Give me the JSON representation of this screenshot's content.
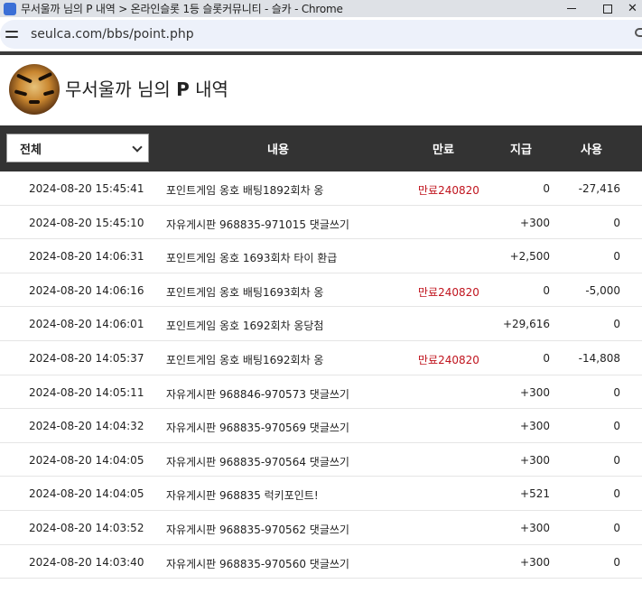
{
  "browser": {
    "tab_title": "무서울까 님의 P 내역 > 온라인슬롯 1등 슬롯커뮤니티 - 슬카 - Chrome",
    "url": "seulca.com/bbs/point.php"
  },
  "page": {
    "title_prefix": "무서울까 님의 ",
    "title_bold": "P",
    "title_suffix": " 내역"
  },
  "table": {
    "filter_value": "전체",
    "headers": {
      "content": "내용",
      "expire": "만료",
      "give": "지급",
      "use": "사용"
    },
    "rows": [
      {
        "date": "2024-08-20 15:45:41",
        "desc": "포인트게임 옹호 배팅1892회차 옹",
        "expire": "만료240820",
        "give": "0",
        "use": "-27,416"
      },
      {
        "date": "2024-08-20 15:45:10",
        "desc": "자유게시판 968835-971015 댓글쓰기",
        "expire": "",
        "give": "+300",
        "use": "0"
      },
      {
        "date": "2024-08-20 14:06:31",
        "desc": "포인트게임 옹호 1693회차 타이 환급",
        "expire": "",
        "give": "+2,500",
        "use": "0"
      },
      {
        "date": "2024-08-20 14:06:16",
        "desc": "포인트게임 옹호 배팅1693회차 옹",
        "expire": "만료240820",
        "give": "0",
        "use": "-5,000"
      },
      {
        "date": "2024-08-20 14:06:01",
        "desc": "포인트게임 옹호 1692회차 옹당첨",
        "expire": "",
        "give": "+29,616",
        "use": "0"
      },
      {
        "date": "2024-08-20 14:05:37",
        "desc": "포인트게임 옹호 배팅1692회차 옹",
        "expire": "만료240820",
        "give": "0",
        "use": "-14,808"
      },
      {
        "date": "2024-08-20 14:05:11",
        "desc": "자유게시판 968846-970573 댓글쓰기",
        "expire": "",
        "give": "+300",
        "use": "0"
      },
      {
        "date": "2024-08-20 14:04:32",
        "desc": "자유게시판 968835-970569 댓글쓰기",
        "expire": "",
        "give": "+300",
        "use": "0"
      },
      {
        "date": "2024-08-20 14:04:05",
        "desc": "자유게시판 968835-970564 댓글쓰기",
        "expire": "",
        "give": "+300",
        "use": "0"
      },
      {
        "date": "2024-08-20 14:04:05",
        "desc": "자유게시판 968835 럭키포인트!",
        "expire": "",
        "give": "+521",
        "use": "0"
      },
      {
        "date": "2024-08-20 14:03:52",
        "desc": "자유게시판 968835-970562 댓글쓰기",
        "expire": "",
        "give": "+300",
        "use": "0"
      },
      {
        "date": "2024-08-20 14:03:40",
        "desc": "자유게시판 968835-970560 댓글쓰기",
        "expire": "",
        "give": "+300",
        "use": "0"
      }
    ]
  },
  "colors": {
    "header_bg": "#333333",
    "expire_text": "#c0141e",
    "addressbar_bg": "#edf1fa"
  },
  "icons": {
    "site_info": "tune-icon",
    "window_controls": [
      "minimize-icon",
      "maximize-icon",
      "close-icon"
    ]
  }
}
